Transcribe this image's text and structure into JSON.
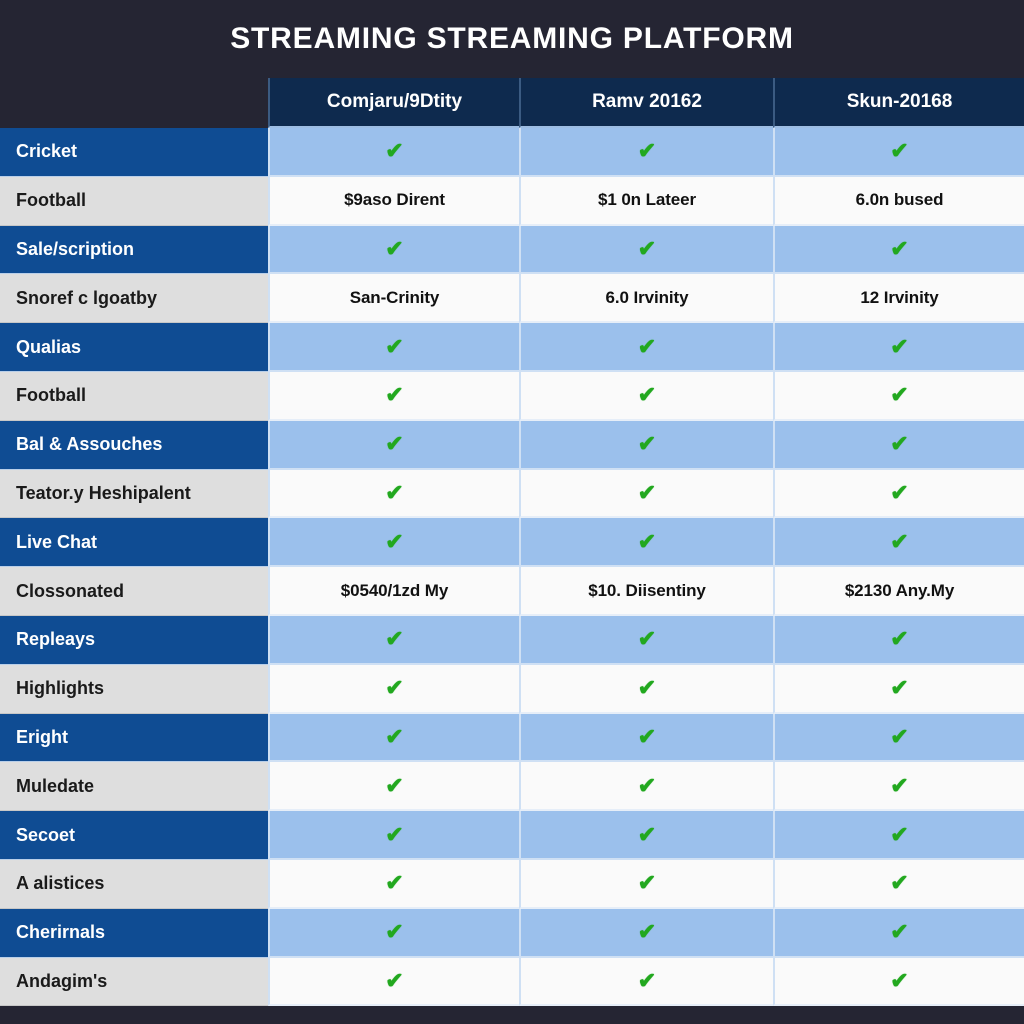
{
  "page": {
    "title": "STREAMING STREAMING PLATFORM",
    "background_color": "#252533",
    "accent_blue": "#0F4C93",
    "header_navy": "#0E2A4E",
    "band_blue": "#9BC0EC",
    "band_white": "#FAFAFA",
    "check_green": "#22A81F"
  },
  "table": {
    "columns": [
      {
        "key": "feature",
        "label": ""
      },
      {
        "key": "col1",
        "label": "Comjaru/9Dtity"
      },
      {
        "key": "col2",
        "label": "Ramv 20162"
      },
      {
        "key": "col3",
        "label": "Skun-20168"
      }
    ],
    "check_glyph": "✔",
    "rows": [
      {
        "label": "Cricket",
        "band": "blue",
        "cells": [
          "check",
          "check",
          "check"
        ]
      },
      {
        "label": "Football",
        "band": "white",
        "cells": [
          "$9aso Dirent",
          "$1 0n Lateer",
          "6.0n bused"
        ]
      },
      {
        "label": "Sale/scription",
        "band": "blue",
        "cells": [
          "check",
          "check",
          "check"
        ]
      },
      {
        "label": "Snoref c lgoatby",
        "band": "white",
        "cells": [
          "San-Crinity",
          "6.0 Irvinity",
          "12 Irvinity"
        ]
      },
      {
        "label": "Qualias",
        "band": "blue",
        "cells": [
          "check",
          "check",
          "check"
        ]
      },
      {
        "label": "Football",
        "band": "white",
        "cells": [
          "check",
          "check",
          "check"
        ]
      },
      {
        "label": "Bal & Assouches",
        "band": "blue",
        "cells": [
          "check",
          "check",
          "check"
        ]
      },
      {
        "label": "Teator.y Heshipalent",
        "band": "white",
        "cells": [
          "check",
          "check",
          "check"
        ]
      },
      {
        "label": "Live Chat",
        "band": "blue",
        "cells": [
          "check",
          "check",
          "check"
        ]
      },
      {
        "label": "Clossonated",
        "band": "white",
        "cells": [
          "$0540/1zd My",
          "$10. Diisentiny",
          "$2130 Any.My"
        ]
      },
      {
        "label": "Repleays",
        "band": "blue",
        "cells": [
          "check",
          "check",
          "check"
        ]
      },
      {
        "label": "Highlights",
        "band": "white",
        "cells": [
          "check",
          "check",
          "check"
        ]
      },
      {
        "label": "Eright",
        "band": "blue",
        "cells": [
          "check",
          "check",
          "check"
        ]
      },
      {
        "label": "Muledate",
        "band": "white",
        "cells": [
          "check",
          "check",
          "check"
        ]
      },
      {
        "label": "Secoet",
        "band": "blue",
        "cells": [
          "check",
          "check",
          "check"
        ]
      },
      {
        "label": "A alistices",
        "band": "white",
        "cells": [
          "check",
          "check",
          "check"
        ]
      },
      {
        "label": "Cherirnals",
        "band": "blue",
        "cells": [
          "check",
          "check",
          "check"
        ]
      },
      {
        "label": "Andagim's",
        "band": "white",
        "cells": [
          "check",
          "check",
          "check"
        ]
      }
    ]
  }
}
